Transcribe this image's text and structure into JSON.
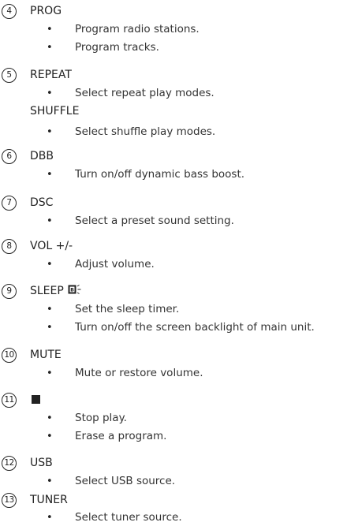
{
  "entries": [
    {
      "number": "4",
      "title": "PROG",
      "bullets": [
        "Program radio stations.",
        "Program tracks."
      ]
    },
    {
      "number": "5",
      "title": "REPEAT",
      "bullets": [
        "Select repeat play modes."
      ],
      "subtitle": "SHUFFLE",
      "sub_bullets": [
        "Select shuffle play modes."
      ]
    },
    {
      "number": "6",
      "title": "DBB",
      "bullets": [
        "Turn on/off dynamic bass boost."
      ]
    },
    {
      "number": "7",
      "title": "DSC",
      "bullets": [
        "Select a preset sound setting."
      ]
    },
    {
      "number": "8",
      "title": "VOL +/-",
      "bullets": [
        "Adjust volume."
      ]
    },
    {
      "number": "9",
      "title": "SLEEP",
      "icon": "sleep-backlight-icon",
      "bullets": [
        "Set the sleep timer.",
        "Turn on/off the screen backlight of main unit."
      ]
    },
    {
      "number": "10",
      "title": "MUTE",
      "bullets": [
        "Mute or restore volume."
      ]
    },
    {
      "number": "11",
      "title": "",
      "icon": "stop-square-icon",
      "bullets": [
        "Stop play.",
        "Erase a program."
      ]
    },
    {
      "number": "12",
      "title": "USB",
      "bullets": [
        "Select USB source."
      ]
    },
    {
      "number": "13",
      "title": "TUNER",
      "bullets": [
        "Select tuner source."
      ]
    }
  ],
  "bullet_glyph": "•"
}
